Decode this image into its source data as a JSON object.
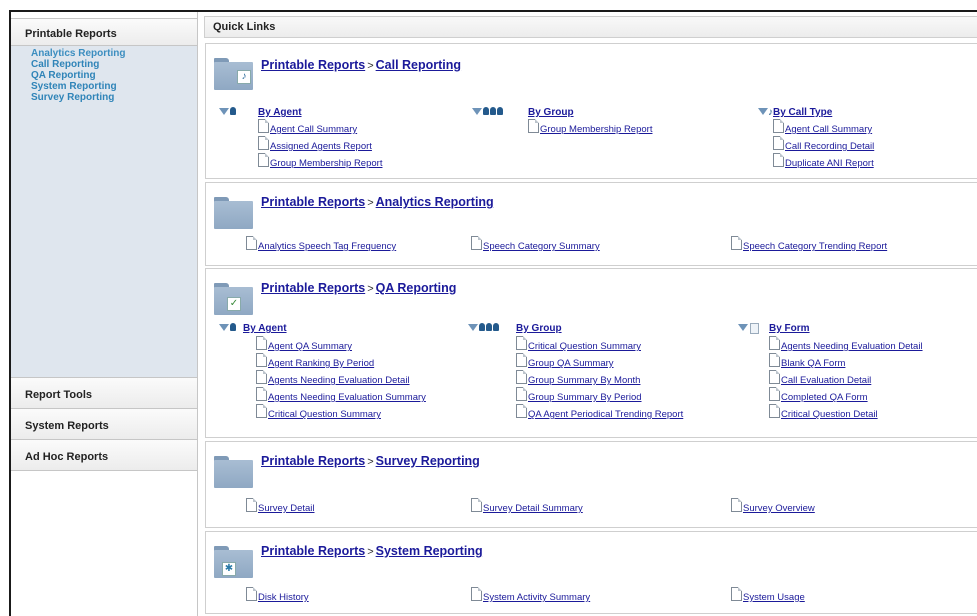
{
  "left_panel": {
    "printable_reports": "Printable Reports",
    "links": [
      "Analytics Reporting",
      "Call Reporting",
      "QA Reporting",
      "System Reporting",
      "Survey Reporting"
    ],
    "report_tools": "Report Tools",
    "system_reports": "System Reports",
    "ad_hoc_reports": "Ad Hoc Reports"
  },
  "quick_links": "Quick Links",
  "breadcrumb_root": "Printable Reports",
  "breadcrumb_sep": ">",
  "sections": {
    "call": {
      "title": "Call Reporting",
      "col1": {
        "head": "By Agent",
        "items": [
          "Agent Call Summary",
          "Assigned Agents Report",
          "Group Membership Report"
        ]
      },
      "col2": {
        "head": "By Group",
        "items": [
          "Group Membership Report"
        ]
      },
      "col3": {
        "head": "By Call Type",
        "items": [
          "Agent Call Summary",
          "Call Recording Detail",
          "Duplicate ANI Report"
        ]
      }
    },
    "analytics": {
      "title": "Analytics Reporting",
      "items": [
        "Analytics Speech Tag Frequency",
        "Speech Category Summary",
        "Speech Category Trending Report"
      ]
    },
    "qa": {
      "title": "QA Reporting",
      "col1": {
        "head": "By Agent",
        "items": [
          "Agent QA Summary",
          "Agent Ranking By Period",
          "Agents Needing Evaluation Detail",
          "Agents Needing Evaluation Summary",
          "Critical Question Summary"
        ]
      },
      "col2": {
        "head": "By Group",
        "items": [
          "Critical Question Summary",
          "Group QA Summary",
          "Group Summary By Month",
          "Group Summary By Period",
          "QA Agent Periodical Trending Report"
        ]
      },
      "col3": {
        "head": "By Form",
        "items": [
          "Agents Needing Evaluation Detail",
          "Blank QA Form",
          "Call Evaluation Detail",
          "Completed QA Form",
          "Critical Question Detail"
        ]
      }
    },
    "survey": {
      "title": "Survey Reporting",
      "items": [
        "Survey Detail",
        "Survey Detail Summary",
        "Survey Overview"
      ]
    },
    "system": {
      "title": "System Reporting",
      "items": [
        "Disk History",
        "System Activity Summary",
        "System Usage"
      ]
    }
  },
  "icons": {
    "filter": "filter-icon",
    "agent": "agent-icon",
    "group": "group-icon",
    "call_type": "call-type-icon",
    "form": "form-icon",
    "document": "document-icon"
  }
}
